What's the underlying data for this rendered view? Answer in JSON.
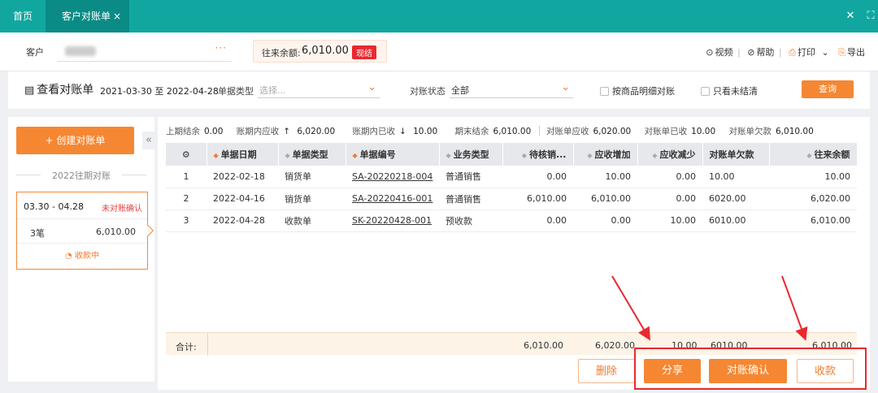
{
  "tabs": {
    "home": "首页",
    "active": "客户对账单",
    "close": "×"
  },
  "window": {
    "close": "✕",
    "maximize": "⛶"
  },
  "customer": {
    "label": "客户",
    "more": "···",
    "balance_label": "往来余额:",
    "balance_value": "6,010.00",
    "balance_badge": "现结"
  },
  "top_actions": {
    "video": "视频",
    "help": "帮助",
    "print": "打印",
    "export": "导出"
  },
  "filter": {
    "title": "查看对账单",
    "date_range": "2021-03-30 至 2022-04-28",
    "doc_type_label": "单据类型",
    "doc_type_placeholder": "选择...",
    "status_label": "对账状态",
    "status_value": "全部",
    "check_detail": "按商品明细对账",
    "check_unsettled": "只看未结清",
    "query_button": "查询"
  },
  "sidebar": {
    "create_button": "+ 创建对账单",
    "collapse": "«",
    "period_header": "2022往期对账",
    "card": {
      "range": "03.30 - 04.28",
      "status": "未对账确认",
      "count": "3笔",
      "amount": "6,010.00",
      "collect_status": "收款中"
    }
  },
  "summary": {
    "open_label": "上期结余",
    "open_value": "0.00",
    "recv_label": "账期内应收",
    "recv_value": "6,020.00",
    "received_label": "账期内已收",
    "received_value": "10.00",
    "close_label": "期末结余",
    "close_value": "6,010.00",
    "stmt_recv_label": "对账单应收",
    "stmt_recv_value": "6,020.00",
    "stmt_received_label": "对账单已收",
    "stmt_received_value": "10.00",
    "stmt_owed_label": "对账单欠款",
    "stmt_owed_value": "6,010.00"
  },
  "table": {
    "headers": [
      "单据日期",
      "单据类型",
      "单据编号",
      "业务类型",
      "待核销...",
      "应收增加",
      "应收减少",
      "对账单欠款",
      "往来余额"
    ],
    "rows": [
      [
        "1",
        "2022-02-18",
        "销货单",
        "SA-20220218-004",
        "普通销售",
        "0.00",
        "10.00",
        "0.00",
        "10.00",
        "10.00"
      ],
      [
        "2",
        "2022-04-16",
        "销货单",
        "SA-20220416-001",
        "普通销售",
        "6,010.00",
        "6,010.00",
        "0.00",
        "6020.00",
        "6,020.00"
      ],
      [
        "3",
        "2022-04-28",
        "收款单",
        "SK-20220428-001",
        "预收款",
        "0.00",
        "0.00",
        "10.00",
        "6010.00",
        "6,010.00"
      ]
    ],
    "footer": {
      "label": "合计:",
      "pending": "6,010.00",
      "increase": "6,020.00",
      "decrease": "10.00",
      "owed": "6010.00",
      "balance": "6,010.00"
    }
  },
  "actions": {
    "delete": "删除",
    "share": "分享",
    "confirm": "对账确认",
    "collect": "收款"
  },
  "colors": {
    "teal": "#11a7a0",
    "orange": "#f58733",
    "red": "#e8292f"
  }
}
